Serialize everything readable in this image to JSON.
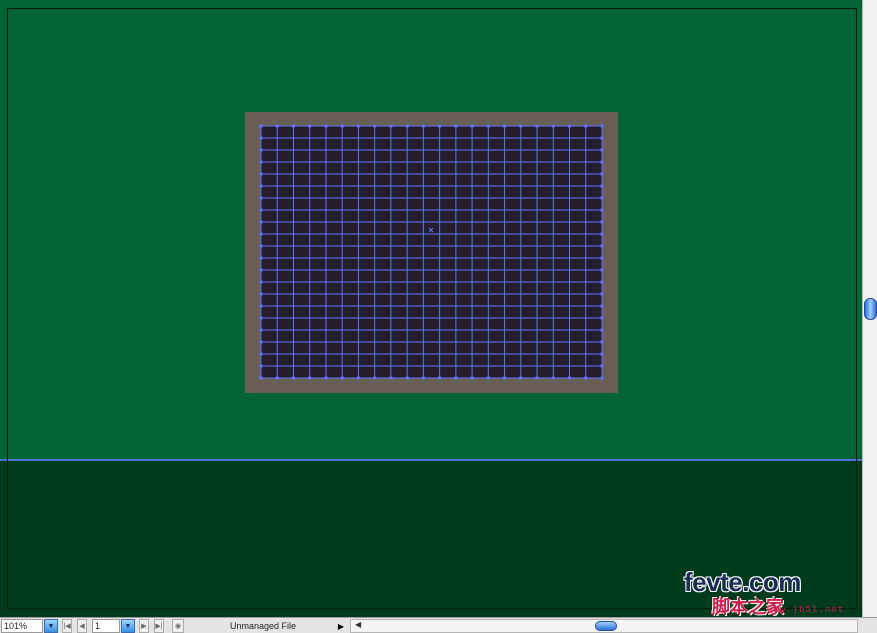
{
  "statusbar": {
    "zoom": "101%",
    "page": "1",
    "status_text": "Unmanaged File",
    "zoom_dropdown_icon": "triangle-down",
    "page_dropdown_icon": "triangle-down"
  },
  "canvas": {
    "background_color": "#036535",
    "lower_region_color": "#003b1c",
    "frame_color": "#6b5e57",
    "grid_fill_color": "#261e2c",
    "grid_line_color": "#5a76ff",
    "guide_color": "#4c74d8"
  },
  "watermark": {
    "main": "fevte.com",
    "cn": "脚本之家",
    "url": "www.jb51.net"
  }
}
